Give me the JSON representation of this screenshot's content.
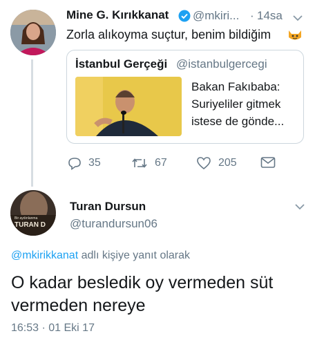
{
  "first_tweet": {
    "name": "Mine G. Kırıkkanat",
    "handle": "@mkiri...",
    "separator": "·",
    "time": "14sa",
    "text": "Zorla alıkoyma suçtur, benim bildiğim",
    "emoji": "cat-face-emoji",
    "quoted": {
      "name": "İstanbul Gerçeği",
      "handle": "@istanbulgercegi",
      "text_lines": [
        "Bakan Fakıbaba:",
        "Suriyeliler gitmek",
        "istese de gönde..."
      ]
    },
    "actions": {
      "replies": "35",
      "retweets": "67",
      "likes": "205"
    }
  },
  "reply_tweet": {
    "name": "Turan Dursun",
    "handle": "@turandursun06",
    "avatar_text_small": "Bir aydınlanma",
    "avatar_text_big": "TURAN D",
    "reply_to_handle": "@mkirikkanat",
    "reply_to_suffix": "adlı kişiye yanıt olarak",
    "text_line1": "O kadar besledik oy vermeden süt",
    "text_line2": "vermeden nereye",
    "timestamp": "16:53 · 01 Eki 17"
  },
  "colors": {
    "link": "#1da1f2",
    "muted": "#657786",
    "verified": "#1da1f2",
    "border": "#ccd6dd"
  }
}
